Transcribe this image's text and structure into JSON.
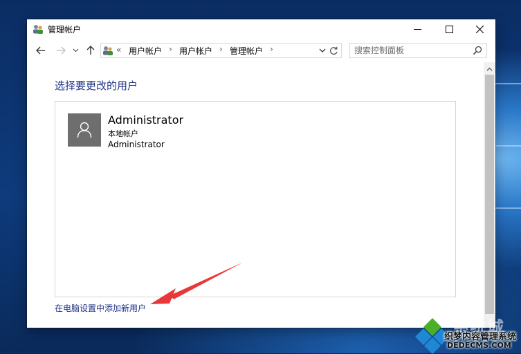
{
  "window": {
    "title": "管理帐户"
  },
  "address": {
    "prefix": "«",
    "crumbs": [
      "用户帐户",
      "用户帐户",
      "管理帐户"
    ]
  },
  "search": {
    "placeholder": "搜索控制面板"
  },
  "main": {
    "heading": "选择要更改的用户",
    "users": [
      {
        "name": "Administrator",
        "type": "本地帐户",
        "subtitle": "Administrator"
      }
    ],
    "add_user_link": "在电脑设置中添加新用户"
  },
  "watermark": {
    "top": "系统城",
    "middle": "织梦内容管理系统",
    "bottom": "DEDECMS.COM"
  },
  "colors": {
    "heading": "#1e3287",
    "link": "#1e3287",
    "avatar_bg": "#6e6e6e",
    "annotation_arrow": "#e8383b"
  },
  "icons": {
    "title": "users-icon",
    "back": "back-arrow-icon",
    "forward": "forward-arrow-icon",
    "recent": "chevron-down-icon",
    "up": "up-arrow-icon",
    "refresh": "refresh-icon",
    "search": "search-icon"
  }
}
